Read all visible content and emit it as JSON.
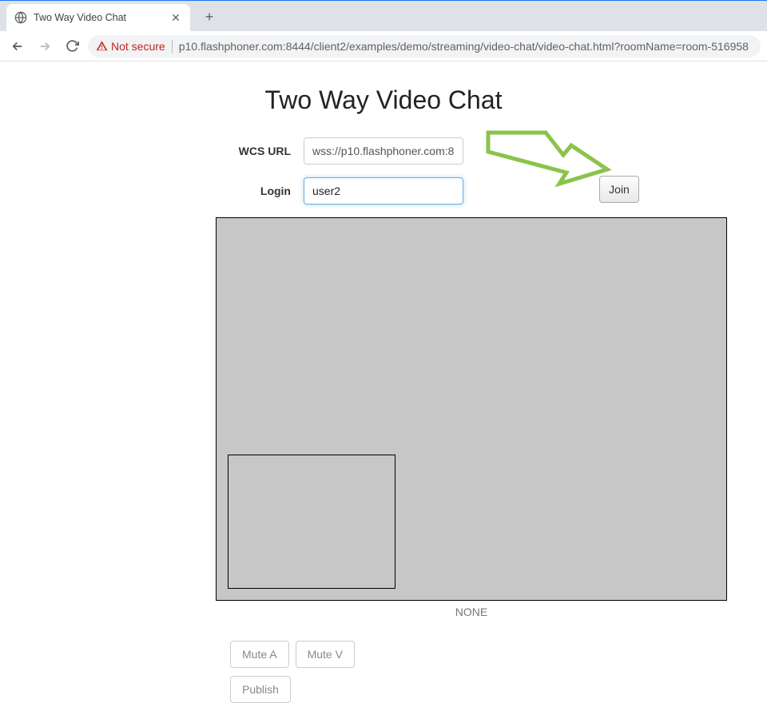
{
  "browser": {
    "tab_title": "Two Way Video Chat",
    "not_secure_label": "Not secure",
    "url": "p10.flashphoner.com:8444/client2/examples/demo/streaming/video-chat/video-chat.html?roomName=room-516958"
  },
  "page": {
    "title": "Two Way Video Chat",
    "wcs_url_label": "WCS URL",
    "wcs_url_value": "wss://p10.flashphoner.com:8",
    "login_label": "Login",
    "login_value": "user2",
    "join_button": "Join",
    "status": "NONE",
    "mute_a": "Mute A",
    "mute_v": "Mute V",
    "publish": "Publish"
  },
  "colors": {
    "arrow": "#8bc34a"
  }
}
